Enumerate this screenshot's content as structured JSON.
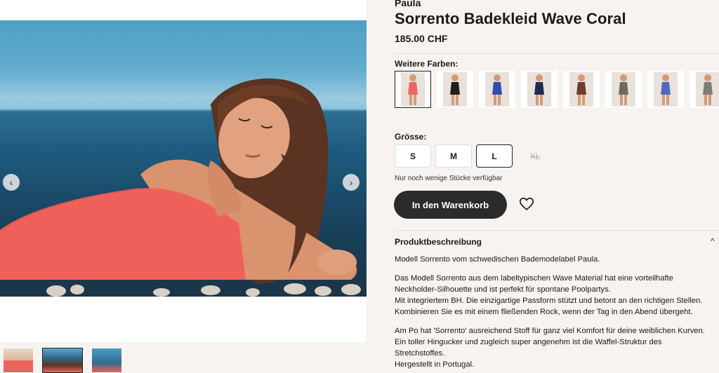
{
  "gallery": {
    "prev_arrow": "‹",
    "next_arrow": "›",
    "thumbnails": [
      "Thumbnail 1",
      "Thumbnail 2",
      "Thumbnail 3"
    ]
  },
  "product": {
    "brand": "Paula",
    "title": "Sorrento Badekleid Wave Coral",
    "price": "185.00 CHF"
  },
  "colors": {
    "label": "Weitere Farben:",
    "swatches": [
      {
        "name": "coral",
        "color": "#e86a63"
      },
      {
        "name": "black",
        "color": "#1e1e1e"
      },
      {
        "name": "royal-blue",
        "color": "#2f4fb0"
      },
      {
        "name": "navy",
        "color": "#1d2a55"
      },
      {
        "name": "brown",
        "color": "#6b4030"
      },
      {
        "name": "olive",
        "color": "#6d6d5a"
      },
      {
        "name": "light-blue",
        "color": "#4d6bbf"
      },
      {
        "name": "grey",
        "color": "#7c7c78"
      }
    ]
  },
  "sizes": {
    "label": "Grösse:",
    "options": [
      "S",
      "M",
      "L",
      "XL"
    ],
    "selected": "L",
    "unavailable": [
      "XL"
    ]
  },
  "stock_note": "Nur noch wenige Stücke verfügbar",
  "cart_button": "In den Warenkorb",
  "description": {
    "heading": "Produktbeschreibung",
    "toggle_icon": "^",
    "paragraphs": [
      "Modell Sorrento vom schwedischen Bademodelabel Paula.",
      "Das Modell Sorrento aus dem labeltypischen Wave Material hat eine vorteilhafte\nNeckholder-Silhouette und ist perfekt für spontane Poolpartys.\nMit integriertem BH. Die einzigartige Passform stützt und betont an den richtigen Stellen.\nKombinieren Sie es mit einem fließenden Rock, wenn der Tag in den Abend übergeht.",
      "Am Po hat 'Sorrento' ausreichend Stoff für ganz viel Komfort für deine weiblichen Kurven.\nEin toller Hingucker und zugleich super angenehm ist die Waffel-Struktur des\nStretchstoffes.\nHergestellt in Portugal."
    ]
  },
  "theme": {
    "accent": "#2b2b2b",
    "background": "#f6f3f0",
    "product_color": "#f0605a"
  }
}
